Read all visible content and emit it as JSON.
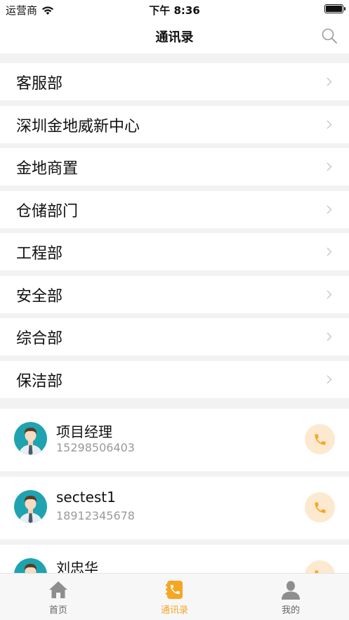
{
  "status_bar": {
    "carrier": "运营商",
    "time": "下午 8:36"
  },
  "header": {
    "title": "通讯录"
  },
  "departments": [
    {
      "label": "客服部"
    },
    {
      "label": "深圳金地威新中心"
    },
    {
      "label": "金地商置"
    },
    {
      "label": "仓储部门"
    },
    {
      "label": "工程部"
    },
    {
      "label": "安全部"
    },
    {
      "label": "综合部"
    },
    {
      "label": "保洁部"
    }
  ],
  "contacts": [
    {
      "name": "项目经理",
      "phone": "15298506403"
    },
    {
      "name": "sectest1",
      "phone": "18912345678"
    },
    {
      "name": "刘忠华",
      "phone": ""
    }
  ],
  "tabs": [
    {
      "label": "首页",
      "icon": "home-icon"
    },
    {
      "label": "通讯录",
      "icon": "contacts-icon",
      "active": true
    },
    {
      "label": "我的",
      "icon": "profile-icon"
    }
  ],
  "colors": {
    "accent": "#f5a623",
    "call_bg": "#fde9cf",
    "avatar_bg": "#1fa3b0"
  }
}
